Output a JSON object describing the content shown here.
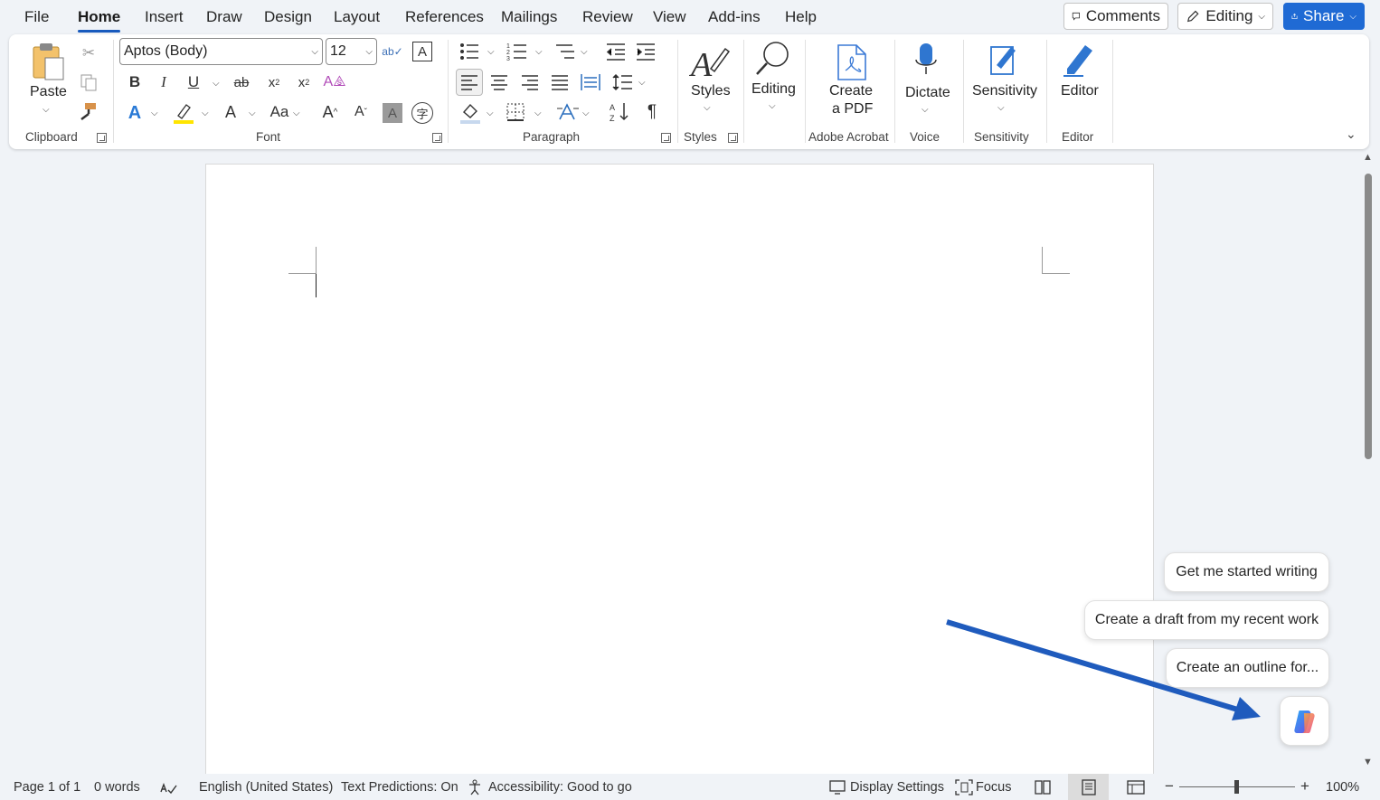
{
  "menu": {
    "tabs": [
      "File",
      "Home",
      "Insert",
      "Draw",
      "Design",
      "Layout",
      "References",
      "Mailings",
      "Review",
      "View",
      "Add-ins",
      "Help"
    ],
    "active_tab": "Home",
    "comments_label": "Comments",
    "editing_label": "Editing",
    "share_label": "Share"
  },
  "ribbon": {
    "clipboard": {
      "paste_label": "Paste",
      "group_label": "Clipboard"
    },
    "font": {
      "font_name": "Aptos (Body)",
      "font_size": "12",
      "group_label": "Font"
    },
    "paragraph": {
      "group_label": "Paragraph"
    },
    "styles": {
      "styles_label": "Styles",
      "group_label": "Styles"
    },
    "editing": {
      "label": "Editing"
    },
    "acrobat": {
      "create_line1": "Create",
      "create_line2": "a PDF",
      "group_label": "Adobe Acrobat"
    },
    "voice": {
      "dictate_label": "Dictate",
      "group_label": "Voice"
    },
    "sensitivity": {
      "label": "Sensitivity",
      "group_label": "Sensitivity"
    },
    "editor": {
      "label": "Editor",
      "group_label": "Editor"
    }
  },
  "copilot": {
    "prompts": [
      "Get me started writing",
      "Create a draft from my recent work",
      "Create an outline for..."
    ],
    "arrow_color": "#1f5bbd"
  },
  "status": {
    "page": "Page 1 of 1",
    "words": "0 words",
    "language": "English (United States)",
    "predictions": "Text Predictions: On",
    "accessibility": "Accessibility: Good to go",
    "display_settings": "Display Settings",
    "focus": "Focus",
    "zoom": "100%"
  },
  "colors": {
    "accent": "#185abd",
    "share": "#1f6ad4",
    "highlight": "#ffe500"
  }
}
